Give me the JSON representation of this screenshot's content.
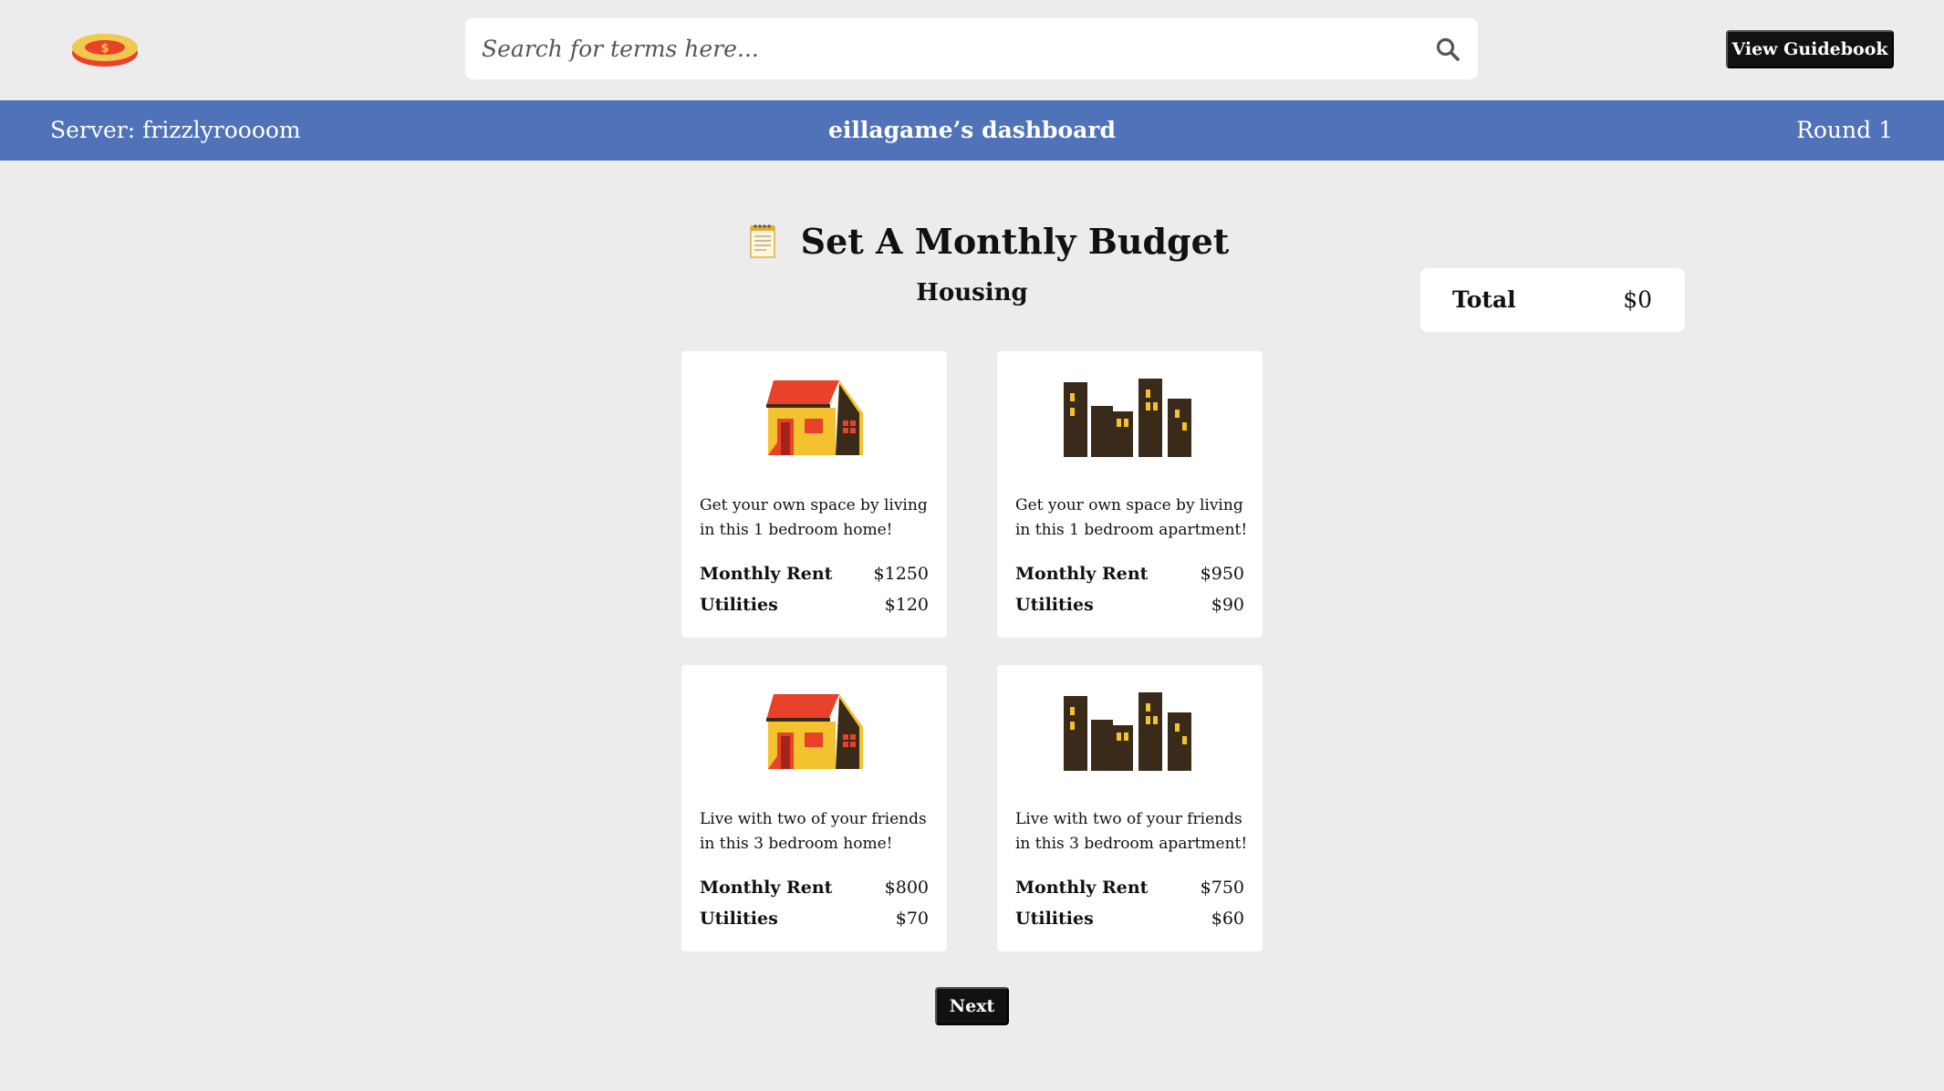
{
  "header": {
    "search_placeholder": "Search for terms here...",
    "guidebook_label": "View Guidebook",
    "icons": {
      "logo": "coin-logo-icon",
      "search": "search-icon"
    }
  },
  "status_bar": {
    "server": "Server: frizzlyroooom",
    "dashboard_title": "eillagame’s dashboard",
    "round": "Round 1",
    "color": "#5072b8"
  },
  "main": {
    "title": "Set A Monthly Budget",
    "title_icon": "notepad-icon",
    "section": "Housing",
    "total": {
      "label": "Total",
      "value": "$0"
    },
    "cards": [
      {
        "icon": "house-icon",
        "description": "Get your own space by living in this 1 bedroom home!",
        "rent_label": "Monthly Rent",
        "rent": "$1250",
        "utilities_label": "Utilities",
        "utilities": "$120"
      },
      {
        "icon": "apartment-buildings-icon",
        "description": "Get your own space by living in this 1 bedroom apartment!",
        "rent_label": "Monthly Rent",
        "rent": "$950",
        "utilities_label": "Utilities",
        "utilities": "$90"
      },
      {
        "icon": "house-icon",
        "description": "Live with two of your friends in this 3 bedroom home!",
        "rent_label": "Monthly Rent",
        "rent": "$800",
        "utilities_label": "Utilities",
        "utilities": "$70"
      },
      {
        "icon": "apartment-buildings-icon",
        "description": "Live with two of your friends in this 3 bedroom apartment!",
        "rent_label": "Monthly Rent",
        "rent": "$750",
        "utilities_label": "Utilities",
        "utilities": "$60"
      }
    ],
    "next_label": "Next"
  }
}
